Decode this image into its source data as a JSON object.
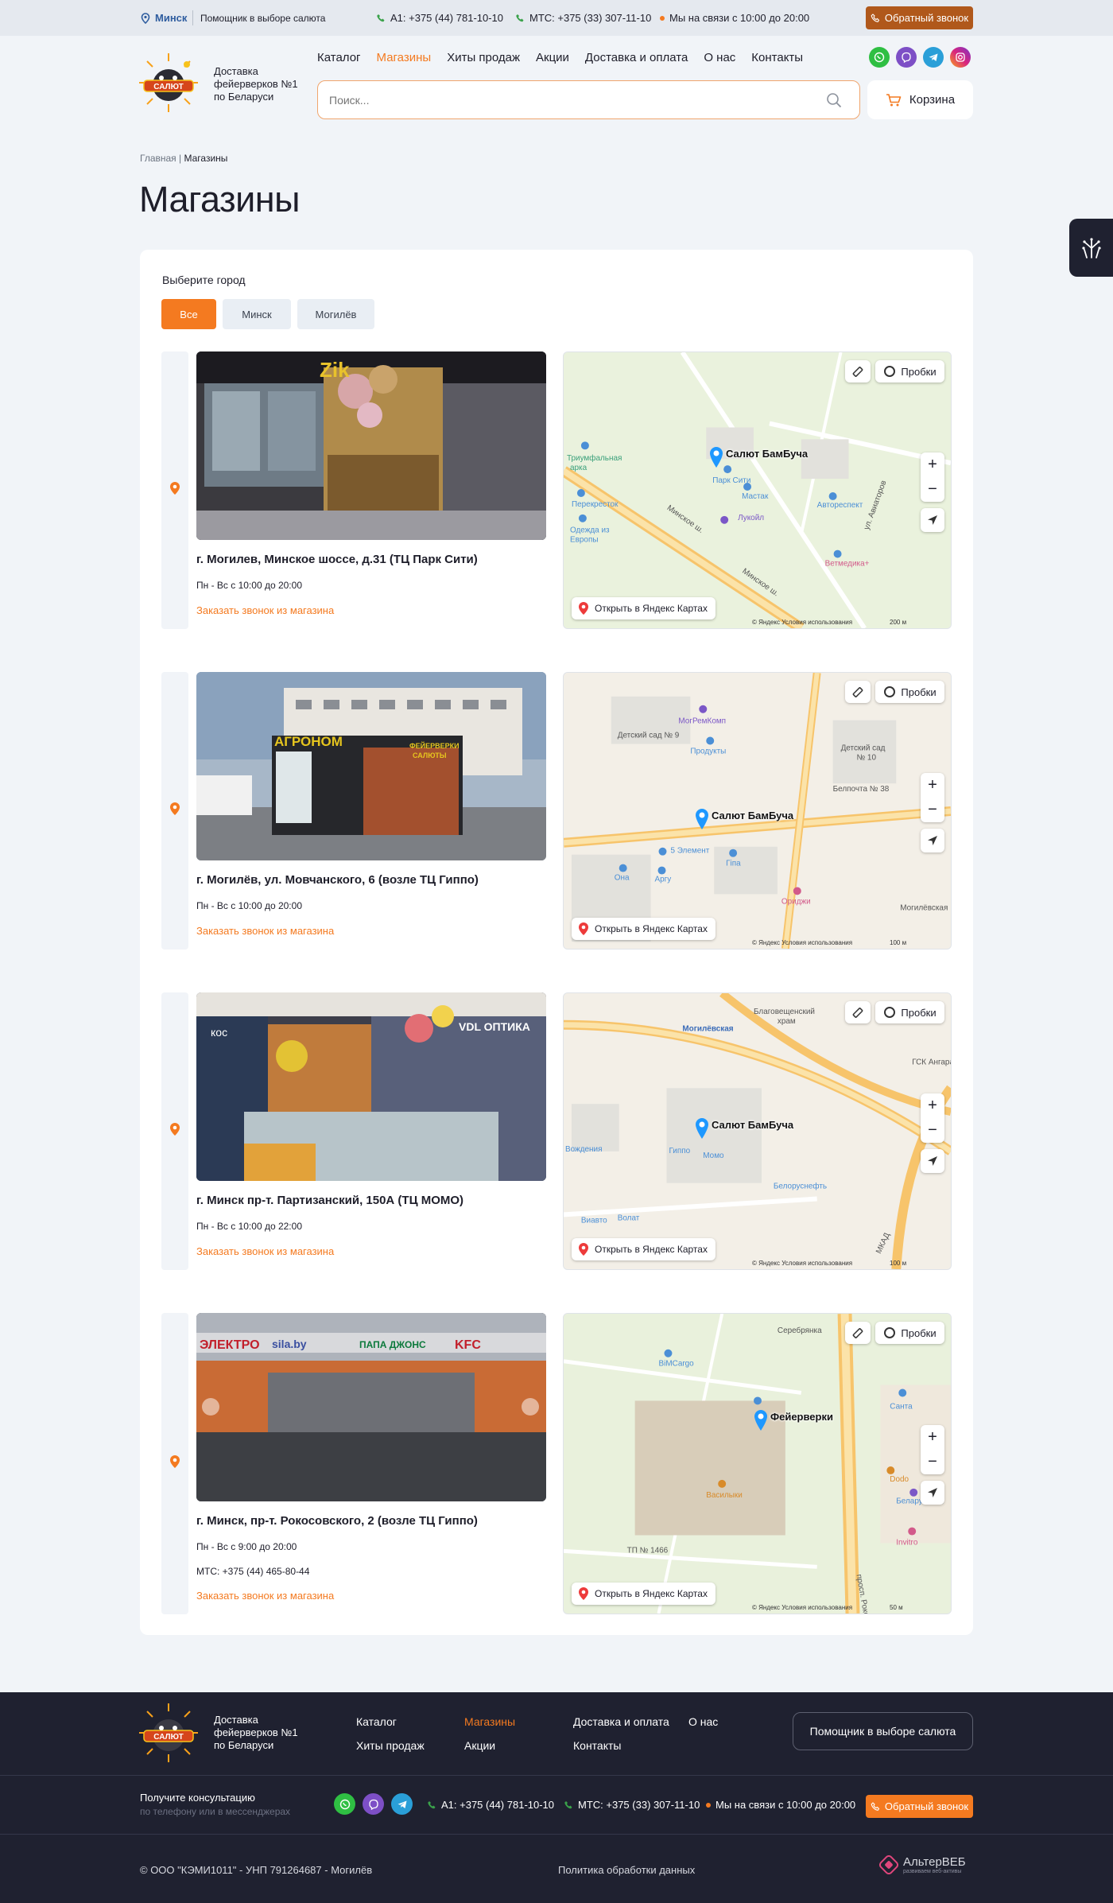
{
  "topbar": {
    "city": "Минск",
    "helper": "Помощник в выборе салюта",
    "phone_a1": "A1: +375 (44) 781-10-10",
    "phone_mts": "МТС: +375 (33) 307-11-10",
    "hours": "Мы на связи с 10:00 до 20:00",
    "callback": "Обратный звонок"
  },
  "header": {
    "logo_caption": [
      "Доставка",
      "фейерверков №1",
      "по Беларуси"
    ],
    "nav": [
      "Каталог",
      "Магазины",
      "Хиты продаж",
      "Акции",
      "Доставка и оплата",
      "О нас",
      "Контакты"
    ],
    "nav_active": "Магазины",
    "search_placeholder": "Поиск...",
    "cart": "Корзина"
  },
  "breadcrumb": {
    "home": "Главная",
    "separator": "|",
    "current": "Магазины"
  },
  "page_title": "Магазины",
  "city_filter": {
    "label": "Выберите город",
    "options": [
      "Все",
      "Минск",
      "Могилёв"
    ],
    "selected": "Все"
  },
  "map_ui": {
    "traffic": "Пробки",
    "open_in_yandex": "Открыть в Яндекс Картах",
    "copyright": "© Яндекс   Условия использования"
  },
  "stores": [
    {
      "address": "г. Могилев, Минское шоссе, д.31 (ТЦ Парк Сити)",
      "hours": "Пн - Вс с 10:00 до 20:00",
      "phone": "",
      "order_call": "Заказать звонок из магазина",
      "map_marker": "Салют БамБуча",
      "map_scale": "200 м",
      "map_labels": [
        "Парк Сити",
        "Минское ш.",
        "Автореспект",
        "Мастак",
        "Лукойл",
        "Ветмедика+",
        "Одежда из Европы",
        "Перекресток",
        "ул. Авиаторов",
        "Триумфальная арка"
      ]
    },
    {
      "address": "г. Могилёв, ул. Мовчанского, 6 (возле ТЦ Гиппо)",
      "hours": "Пн - Вс с 10:00 до 20:00",
      "phone": "",
      "order_call": "Заказать звонок из магазина",
      "map_marker": "Салют БамБуча",
      "map_scale": "100 м",
      "map_labels": [
        "Детский сад № 9",
        "МогРемКомп",
        "Продукты",
        "Детский сад № 10",
        "Белпочта № 38",
        "5 Элемент",
        "Гіпа",
        "Она",
        "Аргу",
        "Ориджи",
        "Могилевская"
      ]
    },
    {
      "address": "г. Минск пр-т. Партизанский, 150А (ТЦ МОМО)",
      "hours": "Пн - Вс с 10:00 до 22:00",
      "phone": "",
      "order_call": "Заказать звонок из магазина",
      "map_marker": "Салют БамБуча",
      "map_scale": "100 м",
      "map_labels": [
        "Благовещенский храм",
        "Могилёвская",
        "Гиппо",
        "Момо",
        "Белоруснефть",
        "Виавто",
        "Волат",
        "Вождения",
        "МКАД",
        "ГСК Ангара"
      ]
    },
    {
      "address": "г. Минск, пр-т. Рокосовского, 2 (возле ТЦ Гиппо)",
      "hours": "Пн - Вс с 9:00 до 20:00",
      "phone": "МТС: +375 (44) 465-80-44",
      "order_call": "Заказать звонок из магазина",
      "map_marker": "Фейерверки",
      "map_scale": "50 м",
      "map_labels": [
        "Серебрянка",
        "BiMCargo",
        "Санта",
        "Василыки",
        "Dodo",
        "Беларусбанк",
        "Invitro",
        "ТП № 1466",
        "просп. Рокоссовского"
      ]
    }
  ],
  "footer": {
    "logo_caption": [
      "Доставка",
      "фейерверков №1",
      "по Беларуси"
    ],
    "nav_col1": [
      "Каталог",
      "Хиты продаж"
    ],
    "nav_col2": [
      "Магазины",
      "Акции"
    ],
    "nav_col3": [
      "Доставка и оплата",
      "Контакты"
    ],
    "nav_col4": [
      "О нас"
    ],
    "nav_active": "Магазины",
    "helper_button": "Помощник в выборе салюта",
    "consult_title": "Получите консультацию",
    "consult_sub": "по телефону или в мессенджерах",
    "phone_a1": "A1: +375 (44) 781-10-10",
    "phone_mts": "МТС: +375 (33) 307-11-10",
    "hours": "Мы на связи с 10:00 до 20:00",
    "callback": "Обратный звонок",
    "copyright": "© ООО \"КЭМИ1011\" - УНП 791264687 - Могилёв",
    "policy": "Политика обработки данных",
    "developer": "АльтерВЕБ",
    "developer_tagline": "развиваем веб-активы"
  },
  "colors": {
    "accent": "#f47a20",
    "topbar_callback": "#b0581b",
    "footer_bg": "#1f2130",
    "page_bg": "#f1f4f8",
    "link_city": "#2f5d9f"
  },
  "icons": [
    "location-pin-icon",
    "phone-icon",
    "whatsapp-icon",
    "viber-icon",
    "telegram-icon",
    "instagram-icon",
    "search-icon",
    "cart-icon",
    "fireworks-icon",
    "ruler-icon",
    "traffic-icon",
    "geolocation-icon",
    "yandex-pin-icon"
  ]
}
